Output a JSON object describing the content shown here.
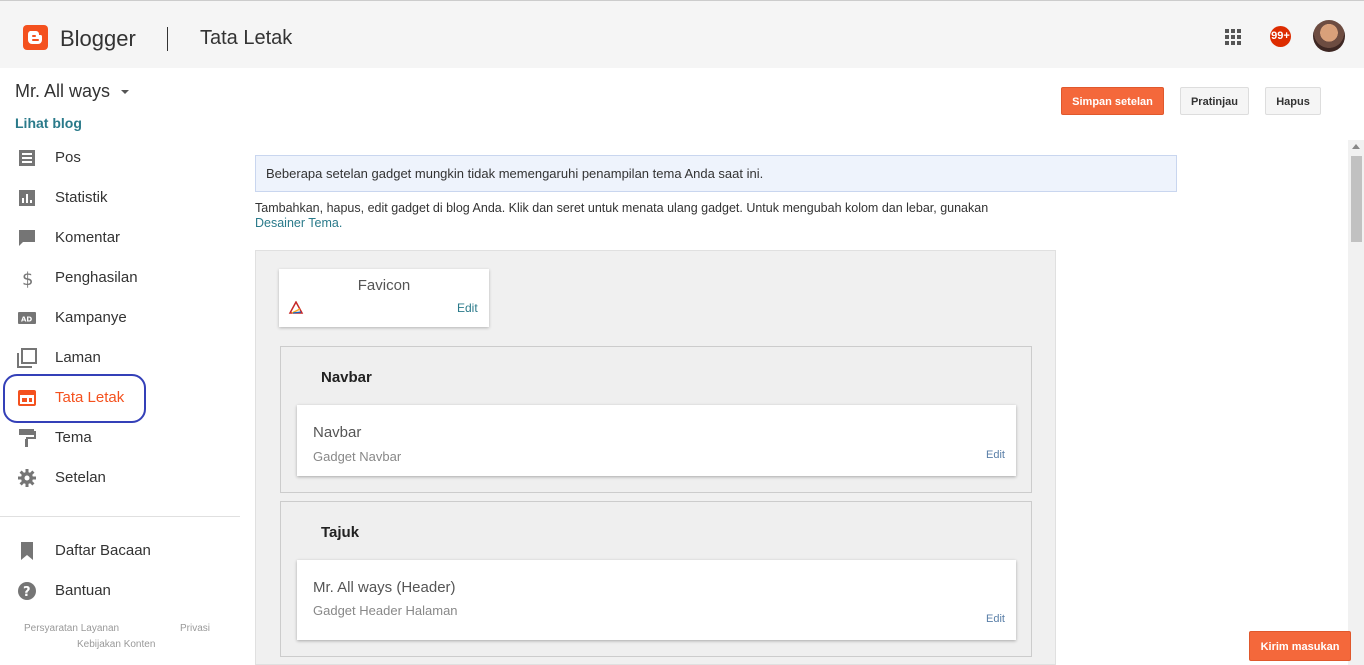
{
  "header": {
    "brand": "Blogger",
    "page_title": "Tata Letak",
    "notification_count": "99+",
    "apps_icon": "apps-grid-icon",
    "logo_color": "#f4511e"
  },
  "sidebar": {
    "blog_name": "Mr. All ways",
    "view_blog": "Lihat blog",
    "items": [
      {
        "label": "Pos",
        "icon": "posts-icon"
      },
      {
        "label": "Statistik",
        "icon": "stats-icon"
      },
      {
        "label": "Komentar",
        "icon": "comment-icon"
      },
      {
        "label": "Penghasilan",
        "icon": "dollar-icon"
      },
      {
        "label": "Kampanye",
        "icon": "ad-icon"
      },
      {
        "label": "Laman",
        "icon": "pages-icon"
      },
      {
        "label": "Tata Letak",
        "icon": "layout-icon",
        "active": true
      },
      {
        "label": "Tema",
        "icon": "paint-roller-icon"
      },
      {
        "label": "Setelan",
        "icon": "gear-icon"
      }
    ],
    "secondary_items": [
      {
        "label": "Daftar Bacaan",
        "icon": "bookmark-icon"
      },
      {
        "label": "Bantuan",
        "icon": "help-icon"
      }
    ],
    "footer": {
      "terms": "Persyaratan Layanan",
      "privacy": "Privasi",
      "content_policy": "Kebijakan Konten"
    }
  },
  "actions": {
    "save": "Simpan setelan",
    "preview": "Pratinjau",
    "delete": "Hapus"
  },
  "main": {
    "info": "Beberapa setelan gadget mungkin tidak memengaruhi penampilan tema Anda saat ini.",
    "description": "Tambahkan, hapus, edit gadget di blog Anda. Klik dan seret untuk menata ulang gadget. Untuk mengubah kolom dan lebar, gunakan",
    "designer_link": "Desainer Tema.",
    "favicon": {
      "title": "Favicon",
      "edit": "Edit"
    },
    "sections": [
      {
        "title": "Navbar",
        "gadget": {
          "name": "Navbar",
          "type": "Gadget Navbar",
          "edit": "Edit"
        }
      },
      {
        "title": "Tajuk",
        "gadget": {
          "name": "Mr. All ways (Header)",
          "type": "Gadget Header Halaman",
          "edit": "Edit"
        }
      }
    ]
  },
  "feedback": "Kirim masukan",
  "colors": {
    "accent": "#f4511e",
    "button": "#f4683b",
    "link": "#2a7a8a",
    "highlight_ring": "#3440b8"
  }
}
